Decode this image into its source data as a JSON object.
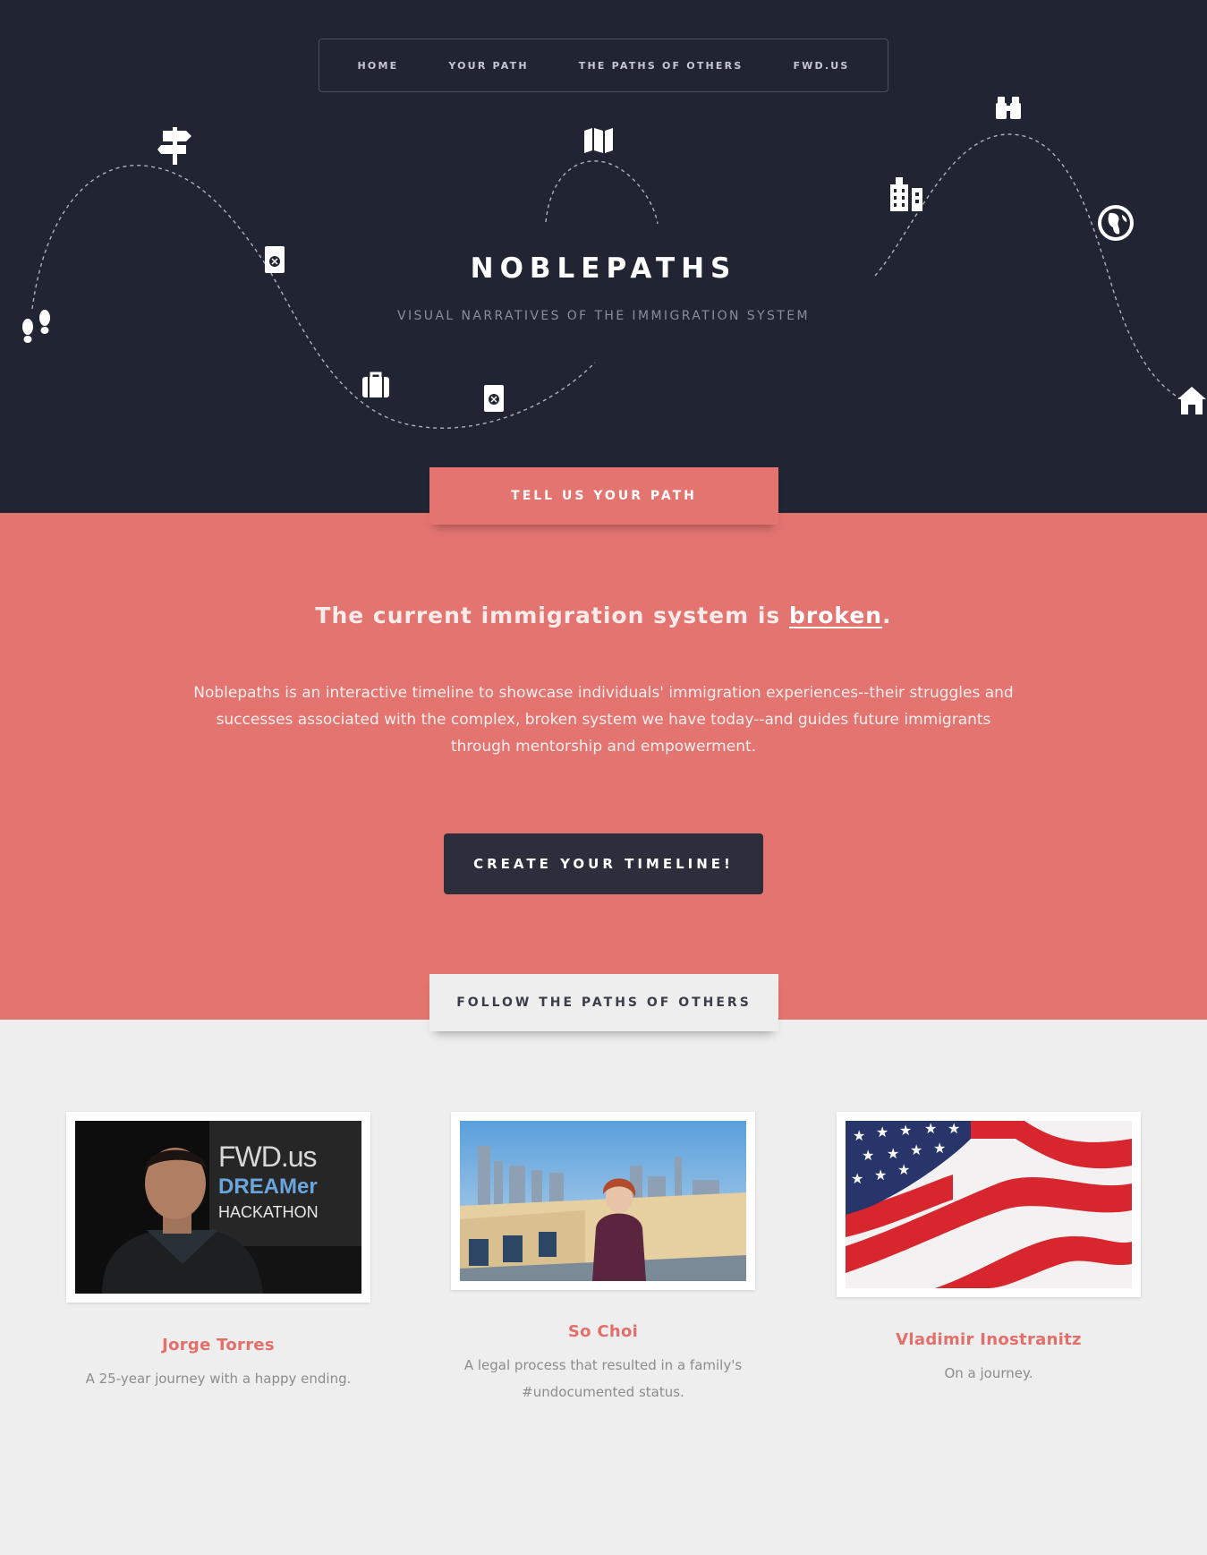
{
  "nav": {
    "items": [
      {
        "label": "HOME"
      },
      {
        "label": "YOUR PATH"
      },
      {
        "label": "THE PATHS OF OTHERS"
      },
      {
        "label": "FWD.US"
      }
    ]
  },
  "hero": {
    "title": "NOBLEPATHS",
    "subtitle": "VISUAL NARRATIVES OF THE IMMIGRATION SYSTEM",
    "icons": [
      "footprints-icon",
      "signpost-icon",
      "passport-icon",
      "suitcase-icon",
      "passport-icon",
      "map-icon",
      "city-icon",
      "binoculars-icon",
      "globe-icon",
      "home-icon"
    ]
  },
  "tabs": {
    "tell_path": "TELL US YOUR PATH",
    "follow_paths": "FOLLOW THE PATHS OF OTHERS"
  },
  "intro": {
    "headline_prefix": "The current immigration system is ",
    "headline_link": "broken",
    "headline_suffix": ".",
    "description": "Noblepaths is an interactive timeline to showcase individuals' immigration experiences--their struggles and successes associated with the complex, broken system we have today--and guides future immigrants through mentorship and empowerment.",
    "cta": "CREATE YOUR TIMELINE!"
  },
  "stories": [
    {
      "name": "Jorge Torres",
      "description": "A 25-year journey with a happy ending.",
      "photo_text": [
        "FWD.us",
        "DREAMer",
        "HACKATHON"
      ]
    },
    {
      "name": "So Choi",
      "description": "A legal process that resulted in a family's #undocumented status."
    },
    {
      "name": "Vladimir Inostranitz",
      "description": "On a journey."
    }
  ],
  "colors": {
    "dark": "#212433",
    "coral": "#e37470",
    "light": "#eeeeee",
    "button": "#2c2f3b"
  }
}
